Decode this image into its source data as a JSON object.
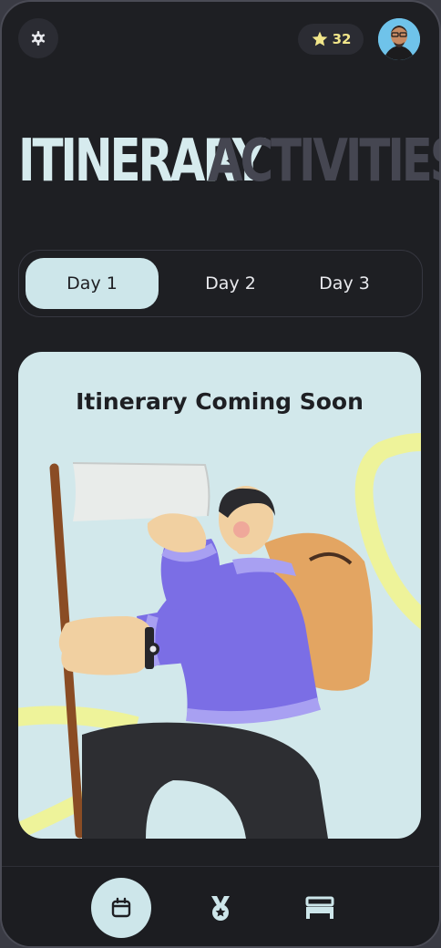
{
  "header": {
    "points": "32",
    "settings_icon": "gear-icon",
    "points_icon": "star-icon"
  },
  "heading": {
    "active": "ITINERARY",
    "inactive": "ACTIVITIES"
  },
  "day_tabs": [
    {
      "label": "Day 1",
      "selected": true
    },
    {
      "label": "Day 2",
      "selected": false
    },
    {
      "label": "Day 3",
      "selected": false
    }
  ],
  "card": {
    "title": "Itinerary Coming Soon"
  },
  "bottom_nav": [
    {
      "icon": "calendar-icon",
      "selected": true
    },
    {
      "icon": "medal-icon",
      "selected": false
    },
    {
      "icon": "bed-icon",
      "selected": false
    }
  ],
  "colors": {
    "background": "#1e1f23",
    "accent": "#cde6ea",
    "star": "#f1e68a",
    "inactive_heading": "#454651"
  }
}
